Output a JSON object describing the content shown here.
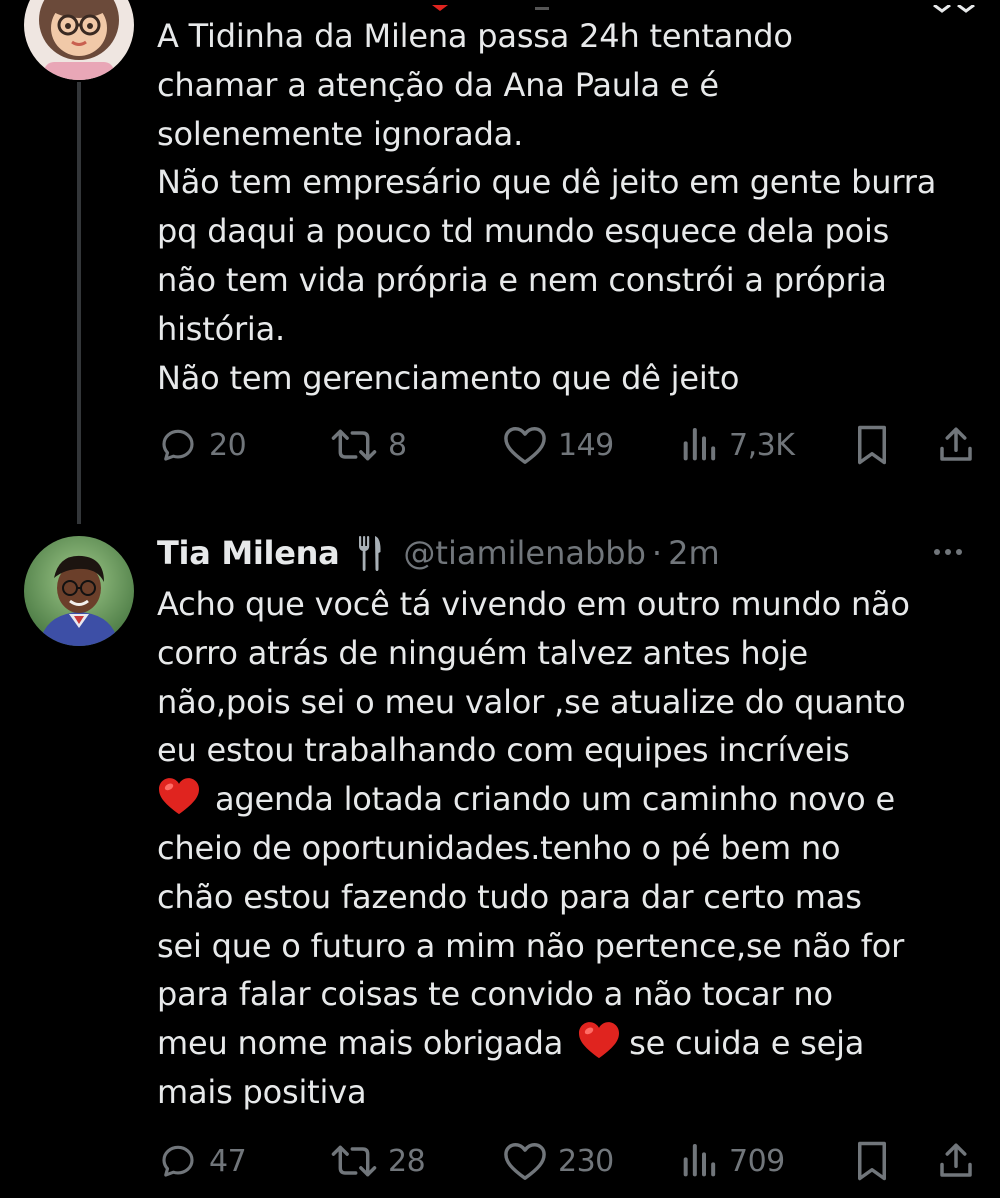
{
  "tweet1": {
    "lines": [
      "A Tidinha da Milena passa 24h tentando",
      "chamar a atenção da Ana Paula e é",
      "solenemente ignorada.",
      "Não tem empresário que dê jeito em gente burra",
      "pq daqui a pouco td mundo esquece dela pois",
      "não tem vida própria e nem constrói a própria",
      "história.",
      "Não tem gerenciamento que dê jeito"
    ],
    "actions": {
      "replies": "20",
      "reposts": "8",
      "likes": "149",
      "views": "7,3K"
    }
  },
  "tweet2": {
    "author_name": "Tia Milena",
    "badge_emoji": "fork-and-knife-icon",
    "handle": "@tiamilenabbb",
    "separator": "·",
    "time": "2m",
    "lines": [
      "Acho que você tá vivendo em outro mundo não",
      "corro atrás de ninguém talvez antes hoje",
      "não,pois sei o meu valor ,se atualize do quanto",
      "eu estou trabalhando com equipes incríveis"
    ],
    "line5_after_heart": "agenda lotada criando um caminho novo e",
    "lines_mid": [
      "cheio de oportunidades.tenho o pé bem no",
      "chão estou fazendo tudo para dar certo mas",
      "sei que o futuro a mim não pertence,se não for",
      "para falar coisas te convido a não tocar no"
    ],
    "line10_before_heart": "meu nome mais obrigada",
    "line10_after_heart": "se cuida e seja",
    "line11": "mais positiva",
    "actions": {
      "replies": "47",
      "reposts": "28",
      "likes": "230",
      "views": "709"
    }
  },
  "colors": {
    "background": "#000000",
    "text": "#e7e9ea",
    "muted": "#71767b",
    "thread_line": "#333639",
    "heart": "#e0241f"
  }
}
